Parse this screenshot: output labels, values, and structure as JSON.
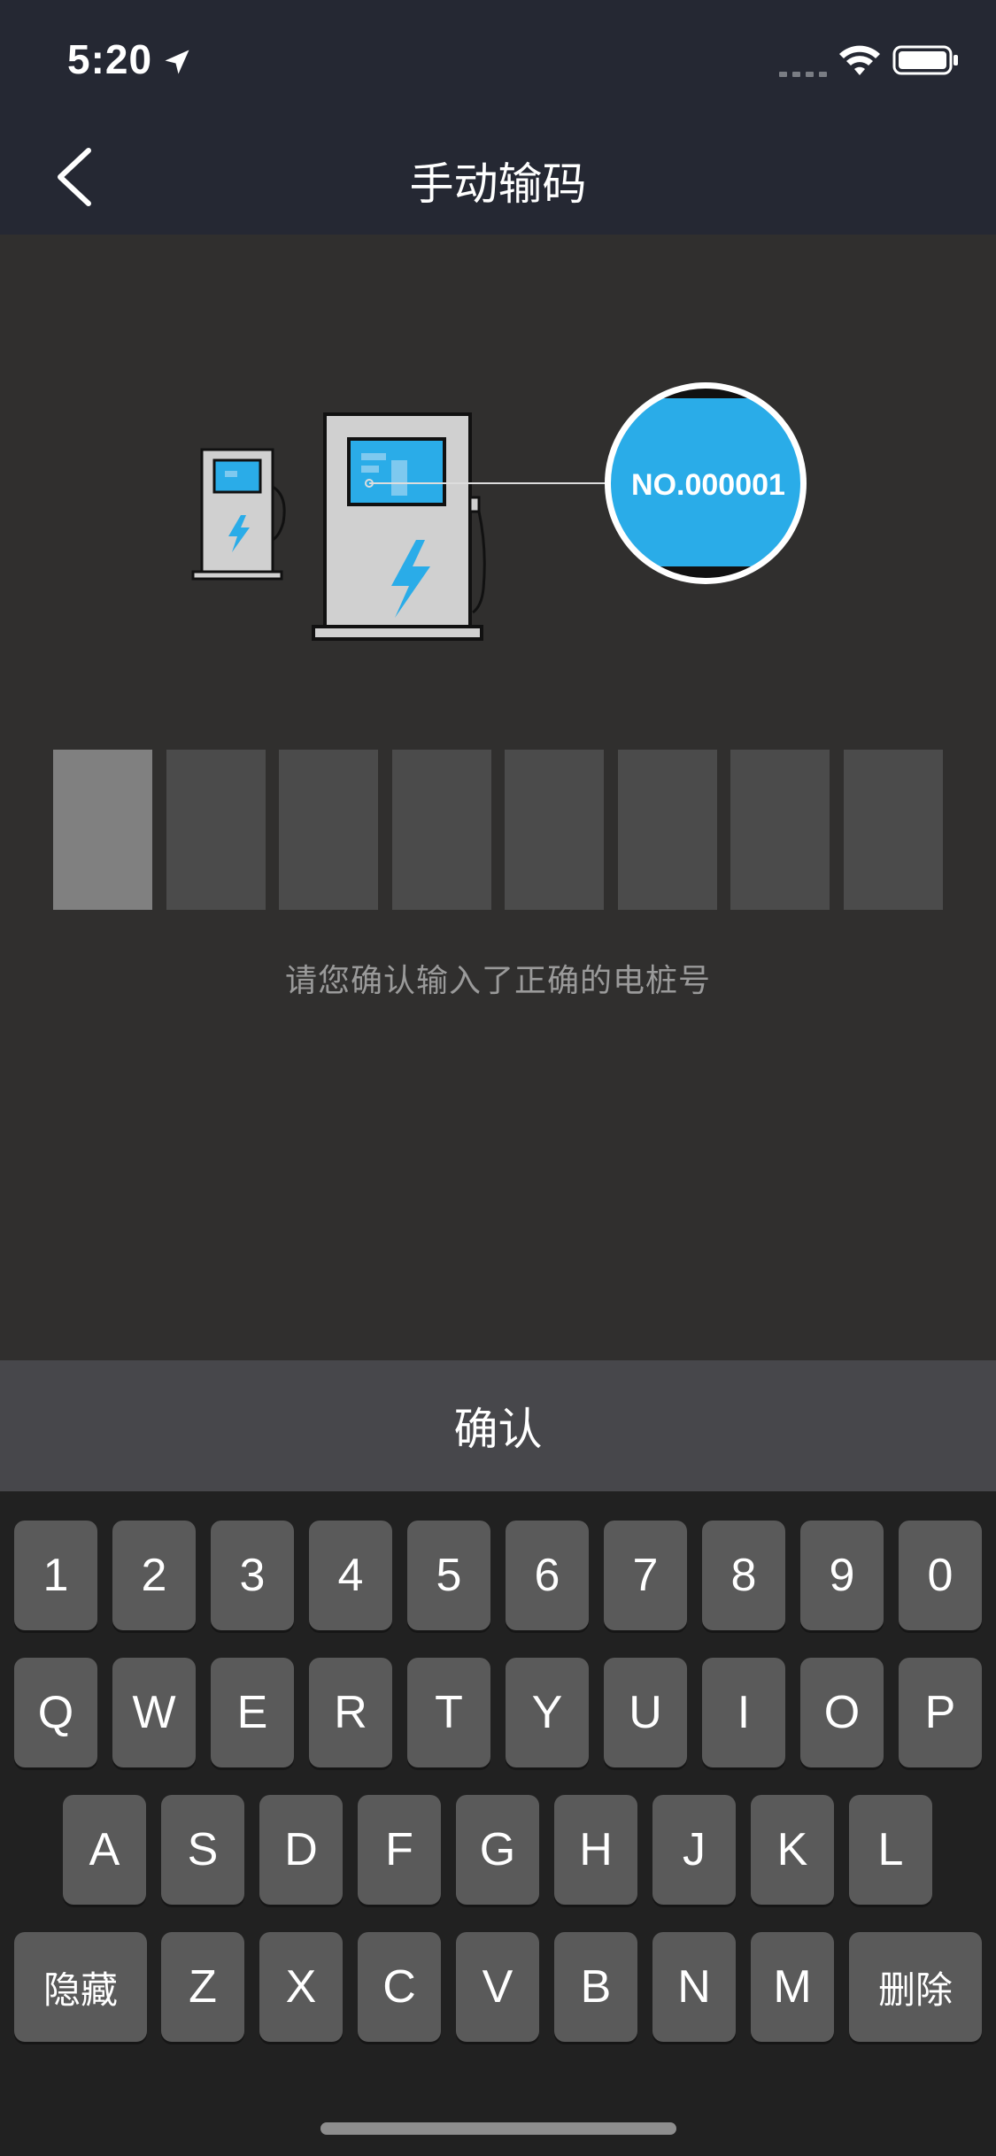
{
  "status_bar": {
    "time": "5:20",
    "icons": [
      "location-arrow-icon",
      "cellular-signal-icon",
      "wifi-icon",
      "battery-icon"
    ]
  },
  "nav": {
    "back_icon": "chevron-left-icon",
    "title": "手动输码"
  },
  "illustration": {
    "plate_text": "NO.000001"
  },
  "code_input": {
    "length": 8,
    "active_index": 0,
    "values": [
      "",
      "",
      "",
      "",
      "",
      "",
      "",
      ""
    ]
  },
  "hint": "请您确认输入了正确的电桩号",
  "confirm_label": "确认",
  "keyboard": {
    "row1": [
      "1",
      "2",
      "3",
      "4",
      "5",
      "6",
      "7",
      "8",
      "9",
      "0"
    ],
    "row2": [
      "Q",
      "W",
      "E",
      "R",
      "T",
      "Y",
      "U",
      "I",
      "O",
      "P"
    ],
    "row3": [
      "A",
      "S",
      "D",
      "F",
      "G",
      "H",
      "J",
      "K",
      "L"
    ],
    "row4": [
      "Z",
      "X",
      "C",
      "V",
      "B",
      "N",
      "M"
    ],
    "hide_label": "隐藏",
    "delete_label": "删除"
  },
  "colors": {
    "header_bg": "#252833",
    "page_bg": "#302f2e",
    "accent_blue": "#2aace8",
    "box_empty": "#4b4b4b",
    "box_active": "#808080"
  }
}
